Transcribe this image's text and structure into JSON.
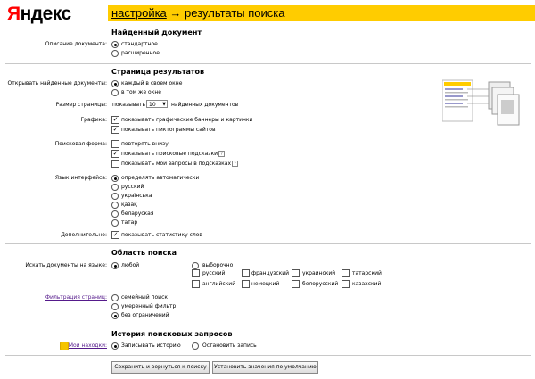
{
  "header": {
    "logo": "Яндекс",
    "breadcrumb_link": "настройка",
    "breadcrumb_arrow": "→",
    "breadcrumb_current": "результаты поиска"
  },
  "found": {
    "title": "Найденный документ",
    "label": "Описание документа:",
    "options": [
      "стандартное",
      "расширенное"
    ]
  },
  "results": {
    "title": "Страница результатов",
    "open_label": "Открывать найденные документы:",
    "open_options": [
      "каждый в своем окне",
      "в том же окне"
    ],
    "size_label": "Размер страницы:",
    "size_prefix": "показывать",
    "size_value": "10",
    "size_suffix": "найденных документов",
    "graphics_label": "Графика:",
    "graphics_options": [
      "показывать графические баннеры и картинки",
      "показывать пиктограммы сайтов"
    ],
    "form_label": "Поисковая форма:",
    "form_options": [
      "повторять внизу",
      "показывать поисковые подсказки",
      "показывать мои запросы в подсказках"
    ],
    "help_mark": "?",
    "lang_label": "Язык интерфейса:",
    "lang_options": [
      "определять автоматически",
      "русский",
      "українська",
      "қазақ",
      "беларуская",
      "татар"
    ],
    "extra_label": "Дополнительно:",
    "extra_option": "показывать статистику слов"
  },
  "area": {
    "title": "Область поиска",
    "lang_label": "Искать документы на языке:",
    "any": "любой",
    "selected": "выборочно",
    "languages": [
      "русский",
      "французский",
      "украинский",
      "татарский",
      "английский",
      "немецкий",
      "белорусский",
      "казахский"
    ],
    "filter_label": "Фильтрация страниц:",
    "filter_options": [
      "семейный поиск",
      "умеренный фильтр",
      "без ограничений"
    ]
  },
  "history": {
    "title": "История поисковых запросов",
    "finds_label": "Мои находки:",
    "options": [
      "Записывать историю",
      "Остановить запись"
    ]
  },
  "buttons": {
    "save": "Сохранить и вернуться к поиску",
    "reset": "Установить значения по умолчанию"
  },
  "colors": {
    "accent": "#ffcc00",
    "logo_red": "#ff0000"
  }
}
